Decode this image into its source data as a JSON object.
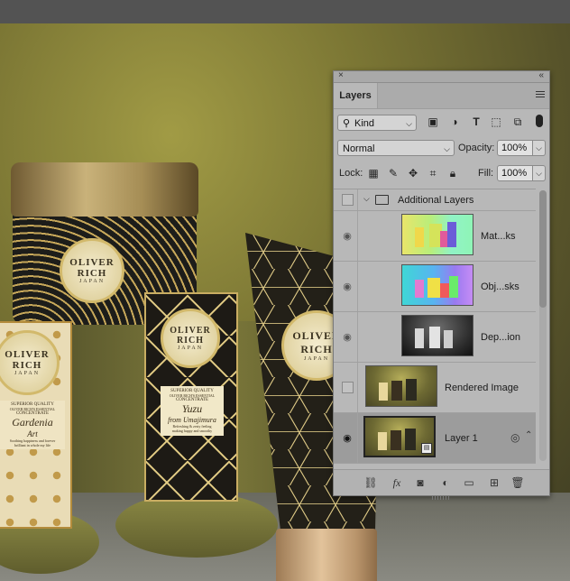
{
  "canvas": {
    "brand_line1": "OLIVER",
    "brand_line2": "RICH",
    "brand_origin": "JAPAN",
    "box_center_copy": {
      "line1": "SUPERIOR QUALITY",
      "line2": "OLIVER RICH'S ESSENTIAL",
      "line3": "CONCENTRATE",
      "product": "Yuzu",
      "subtitle": "from Umajimura",
      "tagline1": "Refreshing & zesty feeling",
      "tagline2": "making happy and smoothy"
    },
    "box_left_copy": {
      "line1": "SUPERIOR QUALITY",
      "line2": "OLIVER RICH'S ESSENTIAL",
      "line3": "CONCENTRATE",
      "product": "Gardenia",
      "subtitle": "Art",
      "tagline1": "Soothing happiness and forever",
      "tagline2": "brilliant in whole my life"
    }
  },
  "panel": {
    "close_label": "×",
    "collapse_label": "«",
    "tab_label": "Layers",
    "filter": {
      "value": "Kind"
    },
    "blend": {
      "value": "Normal"
    },
    "opacity": {
      "label": "Opacity:",
      "value": "100%"
    },
    "lock": {
      "label": "Lock:"
    },
    "fill": {
      "label": "Fill:",
      "value": "100%"
    },
    "layers": [
      {
        "name": "Additional Layers",
        "type": "group",
        "visible": false
      },
      {
        "name": "Mat...ks",
        "type": "pass",
        "visible": true
      },
      {
        "name": "Obj...sks",
        "type": "pass",
        "visible": true
      },
      {
        "name": "Dep...ion",
        "type": "pass",
        "visible": true
      },
      {
        "name": "Rendered Image",
        "type": "image",
        "visible": false
      },
      {
        "name": "Layer 1",
        "type": "smart",
        "visible": true,
        "selected": true
      }
    ],
    "footer_icons": [
      "link-icon",
      "fx-icon",
      "mask-icon",
      "adjustment-icon",
      "folder-icon",
      "new-layer-icon",
      "trash-icon"
    ],
    "footer_fx_label": "fx"
  }
}
